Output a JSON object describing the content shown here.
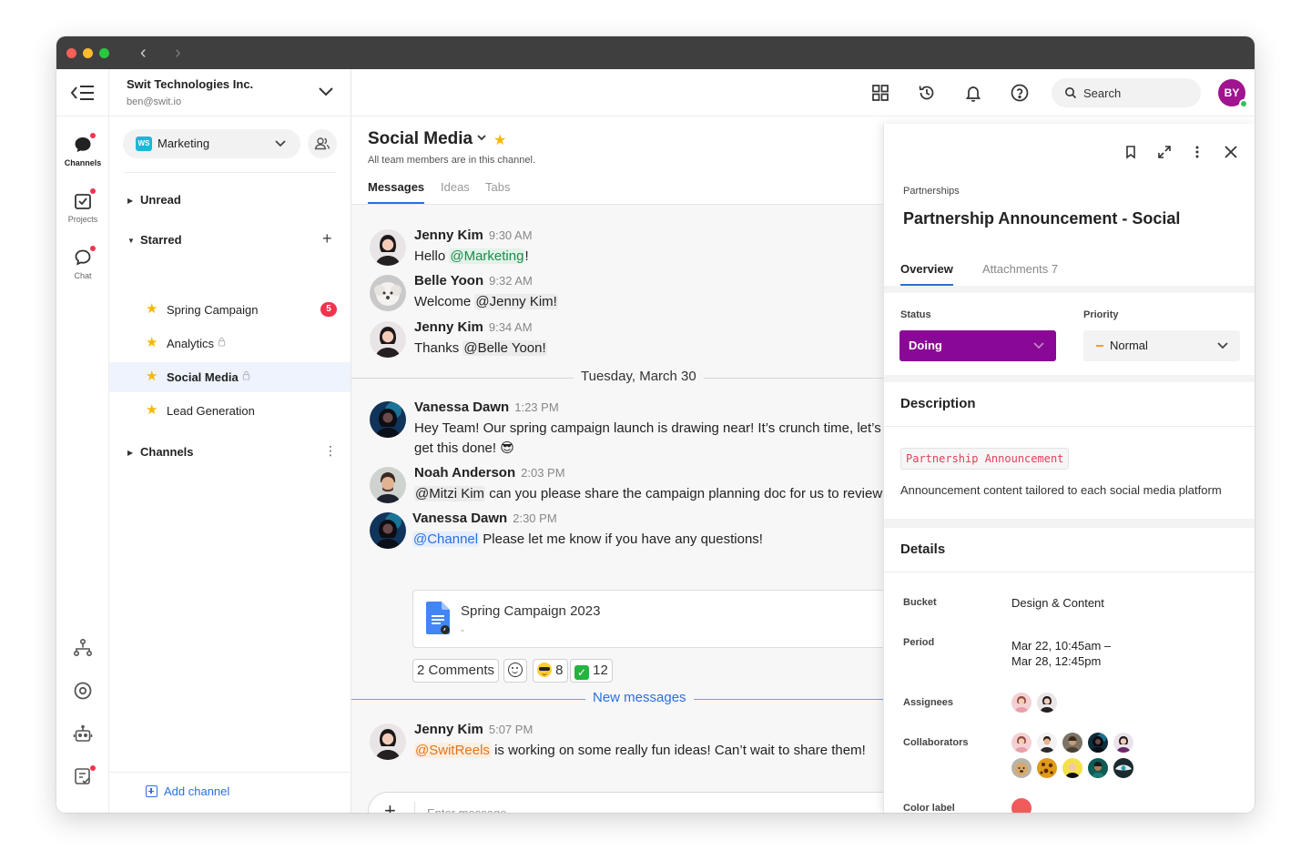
{
  "window": {
    "nav_back": "‹",
    "nav_forward": "›"
  },
  "rail": {
    "items": [
      {
        "label": "Channels",
        "icon": "chat-bubble-icon"
      },
      {
        "label": "Projects",
        "icon": "checkbox-icon"
      },
      {
        "label": "Chat",
        "icon": "chat-icon"
      }
    ],
    "bottom_icons": [
      "org-chart-icon",
      "target-icon",
      "robot-icon",
      "task-list-icon",
      "more-icon"
    ],
    "more_label": "•••"
  },
  "sidebar": {
    "org_name": "Swit Technologies Inc.",
    "org_email": "ben@swit.io",
    "workspace": {
      "badge": "WS",
      "name": "Marketing"
    },
    "groups": {
      "unread": "Unread",
      "starred": "Starred",
      "channels": "Channels"
    },
    "starred_items": [
      {
        "name": "Spring Campaign",
        "badge": "5",
        "locked": false
      },
      {
        "name": "Analytics",
        "badge": "",
        "locked": true
      },
      {
        "name": "Social Media",
        "badge": "",
        "locked": true
      },
      {
        "name": "Lead Generation",
        "badge": "",
        "locked": false
      }
    ],
    "add_channel": "Add channel",
    "plus": "+",
    "kebab": "⋮"
  },
  "topbar": {
    "search_placeholder": "Search",
    "user_initials": "BY",
    "icons": [
      "apps-grid-icon",
      "history-icon",
      "bell-icon",
      "help-icon"
    ]
  },
  "channel": {
    "title": "Social Media",
    "description": "All team members are in this channel.",
    "tabs": [
      "Messages",
      "Ideas",
      "Tabs"
    ],
    "messages": [
      {
        "author": "Jenny Kim",
        "time": "9:30 AM",
        "pre": "Hello ",
        "mention": "@Marketing",
        "post": "!"
      },
      {
        "author": "Belle Yoon",
        "time": "9:32 AM",
        "pre": "Welcome ",
        "mention": "@Jenny Kim!",
        "post": ""
      },
      {
        "author": "Jenny Kim",
        "time": "9:34 AM",
        "pre": "Thanks ",
        "mention": "@Belle Yoon!",
        "post": ""
      },
      {
        "author": "Vanessa Dawn",
        "time": "1:23 PM",
        "text_line1": "Hey Team! Our spring campaign launch is drawing near! It’s crunch time, let’s",
        "text_line2": "get this done! 😎"
      },
      {
        "author": "Noah Anderson",
        "time": "2:03 PM",
        "pre": "",
        "mention": "@Mitzi Kim",
        "post": " can you please share the campaign planning doc for us to review?"
      },
      {
        "author": "Vanessa Dawn",
        "time": "2:30 PM",
        "pre": "",
        "mention": "@Channel",
        "post": " Please let me know if you have any questions!"
      },
      {
        "author": "Jenny Kim",
        "time": "5:07 PM",
        "pre": "",
        "mention": "@SwitReels",
        "post": " is working on some really fun ideas! Can’t wait to share them!"
      }
    ],
    "date_separator": "Tuesday, March 30",
    "new_messages": "New messages",
    "file": {
      "name": "Spring Campaign 2023",
      "sub": "-"
    },
    "reactions": {
      "comments": "2 Comments",
      "cool_count": "8",
      "check_count": "12"
    },
    "composer_placeholder": "Enter message",
    "composer_plus": "+"
  },
  "panel": {
    "breadcrumb": "Partnerships",
    "title": "Partnership Announcement - Social",
    "tabs": {
      "overview": "Overview",
      "attachments": "Attachments 7"
    },
    "status_label": "Status",
    "status_value": "Doing",
    "status_color": "#8a0896",
    "priority_label": "Priority",
    "priority_value": "Normal",
    "description_heading": "Description",
    "code_tag": "Partnership Announcement",
    "description_text": "Announcement content tailored to each social media platform",
    "details_heading": "Details",
    "details": {
      "bucket_key": "Bucket",
      "bucket_value": "Design & Content",
      "period_key": "Period",
      "period_line1": "Mar 22, 10:45am –",
      "period_line2": "Mar 28, 12:45pm",
      "assignees_key": "Assignees",
      "collaborators_key": "Collaborators",
      "color_key": "Color label",
      "color_value": "#f15b5b"
    }
  }
}
